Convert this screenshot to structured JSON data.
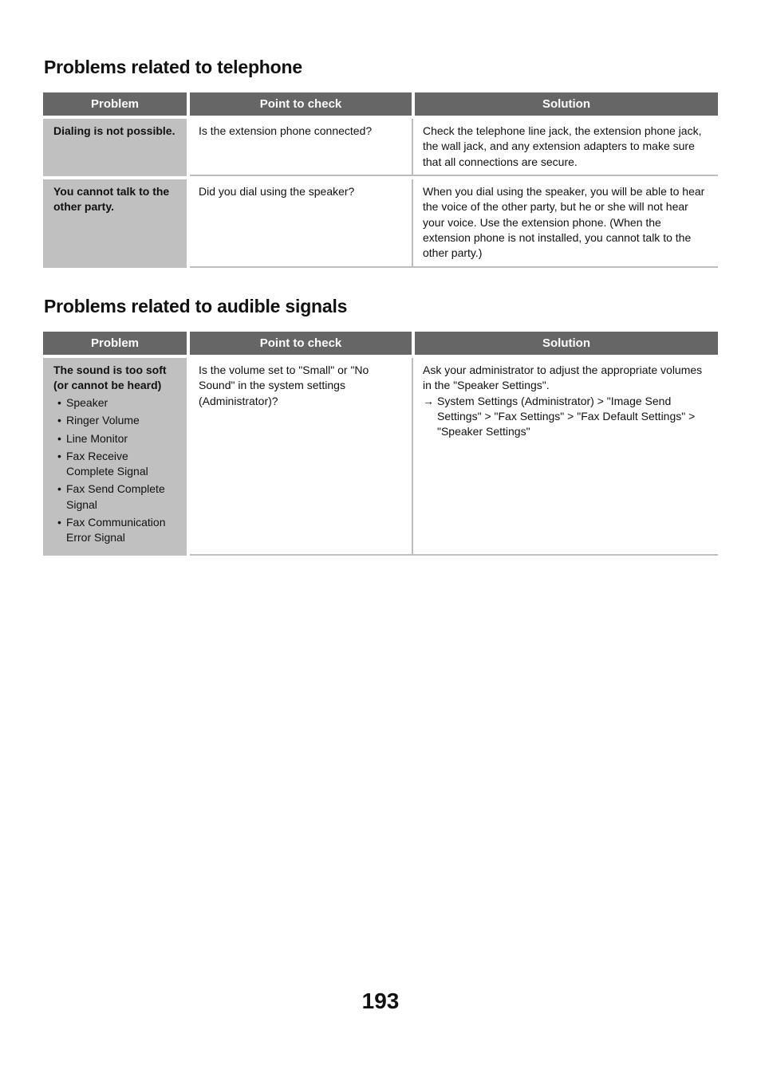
{
  "sections": [
    {
      "title": "Problems related to telephone",
      "headers": [
        "Problem",
        "Point to check",
        "Solution"
      ],
      "rows": [
        {
          "problem": "Dialing is not possible.",
          "check": "Is the extension phone connected?",
          "solution": "Check the telephone line jack, the extension phone jack, the wall jack, and any extension adapters to make sure that all connections are secure."
        },
        {
          "problem": "You cannot talk to the other party.",
          "check": "Did you dial using the speaker?",
          "solution": "When you dial using the speaker, you will be able to hear the voice of the other party, but he or she will not hear your voice. Use the extension phone. (When the extension phone is not installed, you cannot talk to the other party.)"
        }
      ]
    },
    {
      "title": "Problems related to audible signals",
      "headers": [
        "Problem",
        "Point to check",
        "Solution"
      ],
      "rows": [
        {
          "problem": "The sound is too soft (or cannot be heard)",
          "problem_items": [
            "Speaker",
            "Ringer Volume",
            "Line Monitor",
            "Fax Receive Complete Signal",
            "Fax Send Complete Signal",
            "Fax Communication Error Signal"
          ],
          "check": "Is the volume set to \"Small\" or \"No Sound\" in the system settings (Administrator)?",
          "solution": "Ask your administrator to adjust the appropriate volumes in the \"Speaker Settings\".",
          "solution_arrow": "→",
          "solution_path": "System Settings (Administrator) > \"Image Send Settings\" > \"Fax Settings\" > \"Fax Default Settings\" > \"Speaker Settings\""
        }
      ]
    }
  ],
  "page_number": "193"
}
